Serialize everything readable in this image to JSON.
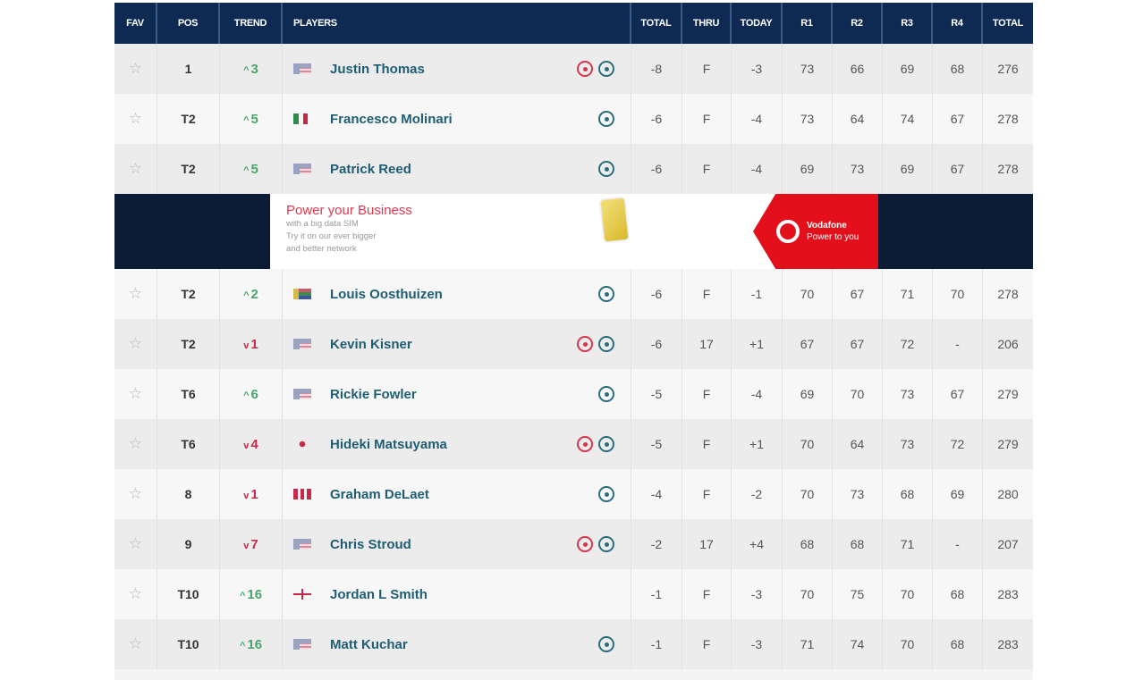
{
  "header": {
    "columns": [
      "FAV",
      "POS",
      "TREND",
      "PLAYERS",
      "TOTAL",
      "THRU",
      "TODAY",
      "R1",
      "R2",
      "R3",
      "R4",
      "TOTAL"
    ]
  },
  "colors": {
    "header_bg": "#0f2a52",
    "trend_up": "#4aa56b",
    "trend_down": "#c8284a",
    "player_name": "#1e5d73",
    "video_icon": "#d8364e",
    "track_icon": "#2a6d7b"
  },
  "players": [
    {
      "pos": "1",
      "trend_dir": "up",
      "trend": "3",
      "flag": "usa",
      "name": "Justin Thomas",
      "video": true,
      "track": true,
      "total": "-8",
      "thru": "F",
      "today": "-3",
      "r1": "73",
      "r2": "66",
      "r3": "69",
      "r4": "68",
      "sum": "276"
    },
    {
      "pos": "T2",
      "trend_dir": "up",
      "trend": "5",
      "flag": "italy",
      "name": "Francesco Molinari",
      "video": false,
      "track": true,
      "total": "-6",
      "thru": "F",
      "today": "-4",
      "r1": "73",
      "r2": "64",
      "r3": "74",
      "r4": "67",
      "sum": "278"
    },
    {
      "pos": "T2",
      "trend_dir": "up",
      "trend": "5",
      "flag": "usa",
      "name": "Patrick Reed",
      "video": false,
      "track": true,
      "total": "-6",
      "thru": "F",
      "today": "-4",
      "r1": "69",
      "r2": "73",
      "r3": "69",
      "r4": "67",
      "sum": "278"
    },
    {
      "pos": "T2",
      "trend_dir": "up",
      "trend": "2",
      "flag": "south-africa",
      "name": "Louis Oosthuizen",
      "video": false,
      "track": true,
      "total": "-6",
      "thru": "F",
      "today": "-1",
      "r1": "70",
      "r2": "67",
      "r3": "71",
      "r4": "70",
      "sum": "278"
    },
    {
      "pos": "T2",
      "trend_dir": "down",
      "trend": "1",
      "flag": "usa",
      "name": "Kevin Kisner",
      "video": true,
      "track": true,
      "total": "-6",
      "thru": "17",
      "today": "+1",
      "r1": "67",
      "r2": "67",
      "r3": "72",
      "r4": "-",
      "sum": "206"
    },
    {
      "pos": "T6",
      "trend_dir": "up",
      "trend": "6",
      "flag": "usa",
      "name": "Rickie Fowler",
      "video": false,
      "track": true,
      "total": "-5",
      "thru": "F",
      "today": "-4",
      "r1": "69",
      "r2": "70",
      "r3": "73",
      "r4": "67",
      "sum": "279"
    },
    {
      "pos": "T6",
      "trend_dir": "down",
      "trend": "4",
      "flag": "japan",
      "name": "Hideki Matsuyama",
      "video": true,
      "track": true,
      "total": "-5",
      "thru": "F",
      "today": "+1",
      "r1": "70",
      "r2": "64",
      "r3": "73",
      "r4": "72",
      "sum": "279"
    },
    {
      "pos": "8",
      "trend_dir": "down",
      "trend": "1",
      "flag": "canada",
      "name": "Graham DeLaet",
      "video": false,
      "track": true,
      "total": "-4",
      "thru": "F",
      "today": "-2",
      "r1": "70",
      "r2": "73",
      "r3": "68",
      "r4": "69",
      "sum": "280"
    },
    {
      "pos": "9",
      "trend_dir": "down",
      "trend": "7",
      "flag": "usa",
      "name": "Chris Stroud",
      "video": true,
      "track": true,
      "total": "-2",
      "thru": "17",
      "today": "+4",
      "r1": "68",
      "r2": "68",
      "r3": "71",
      "r4": "-",
      "sum": "207"
    },
    {
      "pos": "T10",
      "trend_dir": "up",
      "trend": "16",
      "flag": "england",
      "name": "Jordan L Smith",
      "video": false,
      "track": false,
      "total": "-1",
      "thru": "F",
      "today": "-3",
      "r1": "70",
      "r2": "75",
      "r3": "70",
      "r4": "68",
      "sum": "283"
    },
    {
      "pos": "T10",
      "trend_dir": "up",
      "trend": "16",
      "flag": "usa",
      "name": "Matt Kuchar",
      "video": false,
      "track": true,
      "total": "-1",
      "thru": "F",
      "today": "-3",
      "r1": "71",
      "r2": "74",
      "r3": "70",
      "r4": "68",
      "sum": "283"
    }
  ],
  "ad": {
    "title": "Power your Business",
    "lines": [
      "with a big data SIM",
      "Try it on our ever bigger",
      "and better network"
    ],
    "brand": "Vodafone",
    "tagline": "Power to you",
    "insert_after_row": 3
  },
  "icons": {
    "favorite": "star-outline-icon",
    "video": "video-play-icon",
    "track": "shot-tracker-icon",
    "trend_up": "caret-up-icon",
    "trend_down": "caret-down-icon"
  }
}
